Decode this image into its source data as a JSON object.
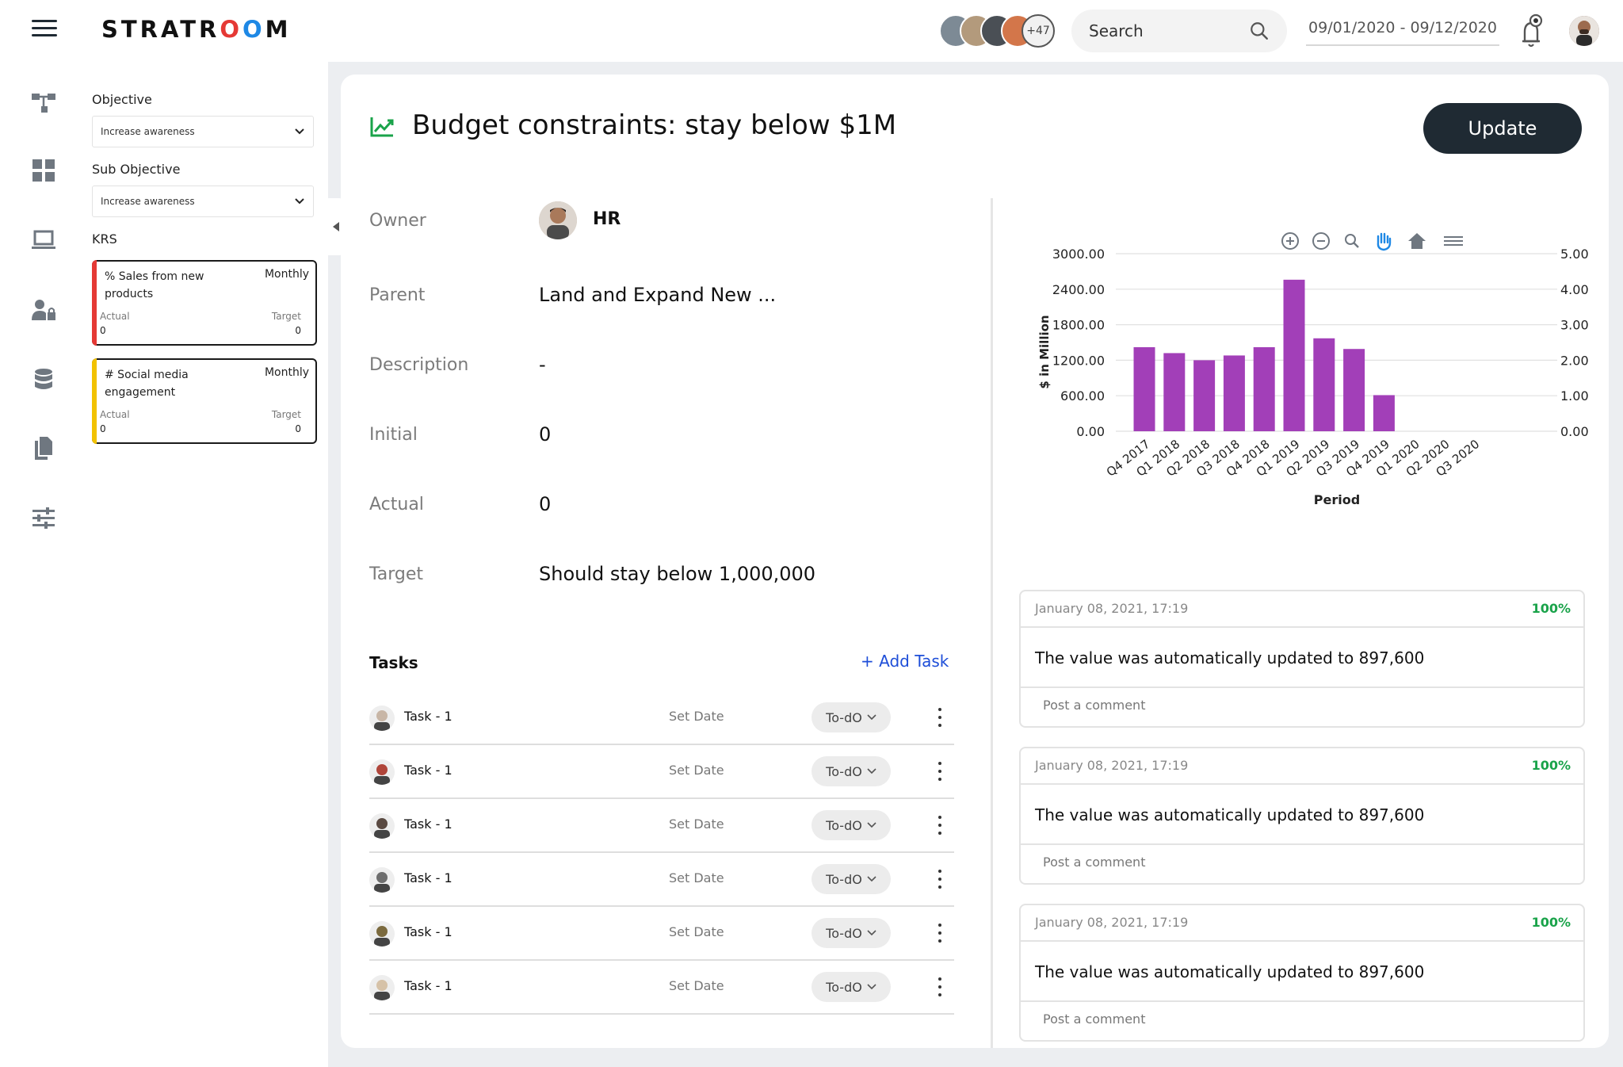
{
  "app": {
    "logo": "STRATROOM",
    "date_range": "09/01/2020 - 09/12/2020"
  },
  "header": {
    "search_label": "Search",
    "team_more": "+47"
  },
  "filters": {
    "objective_label": "Objective",
    "objective_value": "Increase awareness",
    "sub_objective_label": "Sub Objective",
    "sub_objective_value": "Increase awareness",
    "krs_label": "KRS",
    "krs": [
      {
        "title": "% Sales from new products",
        "frequency": "Monthly",
        "actual_label": "Actual",
        "actual_value": "0",
        "target_label": "Target",
        "target_value": "0",
        "color": "#e53935"
      },
      {
        "title": "# Social media engagement",
        "frequency": "Monthly",
        "actual_label": "Actual",
        "actual_value": "0",
        "target_label": "Target",
        "target_value": "0",
        "color": "#f2c200"
      }
    ]
  },
  "detail": {
    "title": "Budget constraints: stay below $1M",
    "update_label": "Update",
    "owner_label": "Owner",
    "owner_value": "HR",
    "parent_label": "Parent",
    "parent_value": "Land and Expand New ...",
    "description_label": "Description",
    "description_value": "-",
    "initial_label": "Initial",
    "initial_value": "0",
    "actual_label": "Actual",
    "actual_value": "0",
    "target_label": "Target",
    "target_value": "Should stay below 1,000,000"
  },
  "tasks": {
    "heading": "Tasks",
    "add_label": "+ Add Task",
    "items": [
      {
        "name": "Task - 1",
        "date": "Set Date",
        "status": "To-dO"
      },
      {
        "name": "Task - 1",
        "date": "Set Date",
        "status": "To-dO"
      },
      {
        "name": "Task - 1",
        "date": "Set Date",
        "status": "To-dO"
      },
      {
        "name": "Task - 1",
        "date": "Set Date",
        "status": "To-dO"
      },
      {
        "name": "Task - 1",
        "date": "Set Date",
        "status": "To-dO"
      },
      {
        "name": "Task - 1",
        "date": "Set Date",
        "status": "To-dO"
      }
    ]
  },
  "chart_data": {
    "type": "bar",
    "categories": [
      "Q4 2017",
      "Q1 2018",
      "Q2 2018",
      "Q3 2018",
      "Q4 2018",
      "Q1 2019",
      "Q2 2019",
      "Q3 2019",
      "Q4 2019",
      "Q1 2020",
      "Q2 2020",
      "Q3 2020"
    ],
    "values": [
      1420,
      1320,
      1200,
      1280,
      1420,
      2560,
      1570,
      1390,
      610,
      null,
      null,
      null
    ],
    "xlabel": "Period",
    "ylabel": "$ in Million",
    "ylim": [
      0,
      3000
    ],
    "y_ticks": [
      "3000.00",
      "2400.00",
      "1800.00",
      "1200.00",
      "600.00",
      "0.00"
    ],
    "y2_ticks": [
      "5.00",
      "4.00",
      "3.00",
      "2.00",
      "1.00",
      "0.00"
    ],
    "bar_color": "#a23fb8",
    "grid": true
  },
  "comments": [
    {
      "date": "January 08, 2021, 17:19",
      "percent": "100%",
      "text": "The value was automatically updated to 897,600",
      "placeholder": "Post a comment"
    },
    {
      "date": "January 08, 2021, 17:19",
      "percent": "100%",
      "text": "The value was automatically updated to 897,600",
      "placeholder": "Post a comment"
    },
    {
      "date": "January 08, 2021, 17:19",
      "percent": "100%",
      "text": "The value was automatically updated to 897,600",
      "placeholder": "Post a comment"
    }
  ]
}
